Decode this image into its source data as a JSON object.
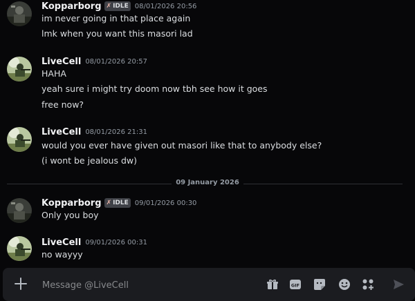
{
  "messages": [
    {
      "user": "Kopparborg",
      "badge": "IDLE",
      "badge_icon": "dagger-icon",
      "time": "08/01/2026 20:56",
      "lines": [
        "im never going in that place again",
        "lmk when you want this masori lad"
      ]
    },
    {
      "user": "LiveCell",
      "time": "08/01/2026 20:57",
      "lines": [
        "HAHA",
        "yeah sure i might try doom now tbh see how it goes",
        "free now?"
      ]
    },
    {
      "user": "LiveCell",
      "time": "08/01/2026 21:31",
      "lines": [
        "would you ever have given out masori like that to anybody else?",
        "(i wont be jealous dw)"
      ]
    },
    {
      "user": "Kopparborg",
      "badge": "IDLE",
      "badge_icon": "dagger-icon",
      "time": "09/01/2026 00:30",
      "lines": [
        "Only you boy"
      ]
    },
    {
      "user": "LiveCell",
      "time": "09/01/2026 00:31",
      "lines": [
        "no wayyy"
      ]
    }
  ],
  "date_divider": "09 January 2026",
  "composer": {
    "placeholder": "Message @LiveCell",
    "tools": [
      "gift-icon",
      "gif-icon",
      "sticker-icon",
      "emoji-icon",
      "apps-icon",
      "send-icon"
    ],
    "gif_label": "GIF"
  },
  "colors": {
    "background": "#070709",
    "composer": "#1b1c20",
    "username": "#f2f3f5",
    "timestamp": "#949ba4",
    "badge": "#3f4147"
  }
}
